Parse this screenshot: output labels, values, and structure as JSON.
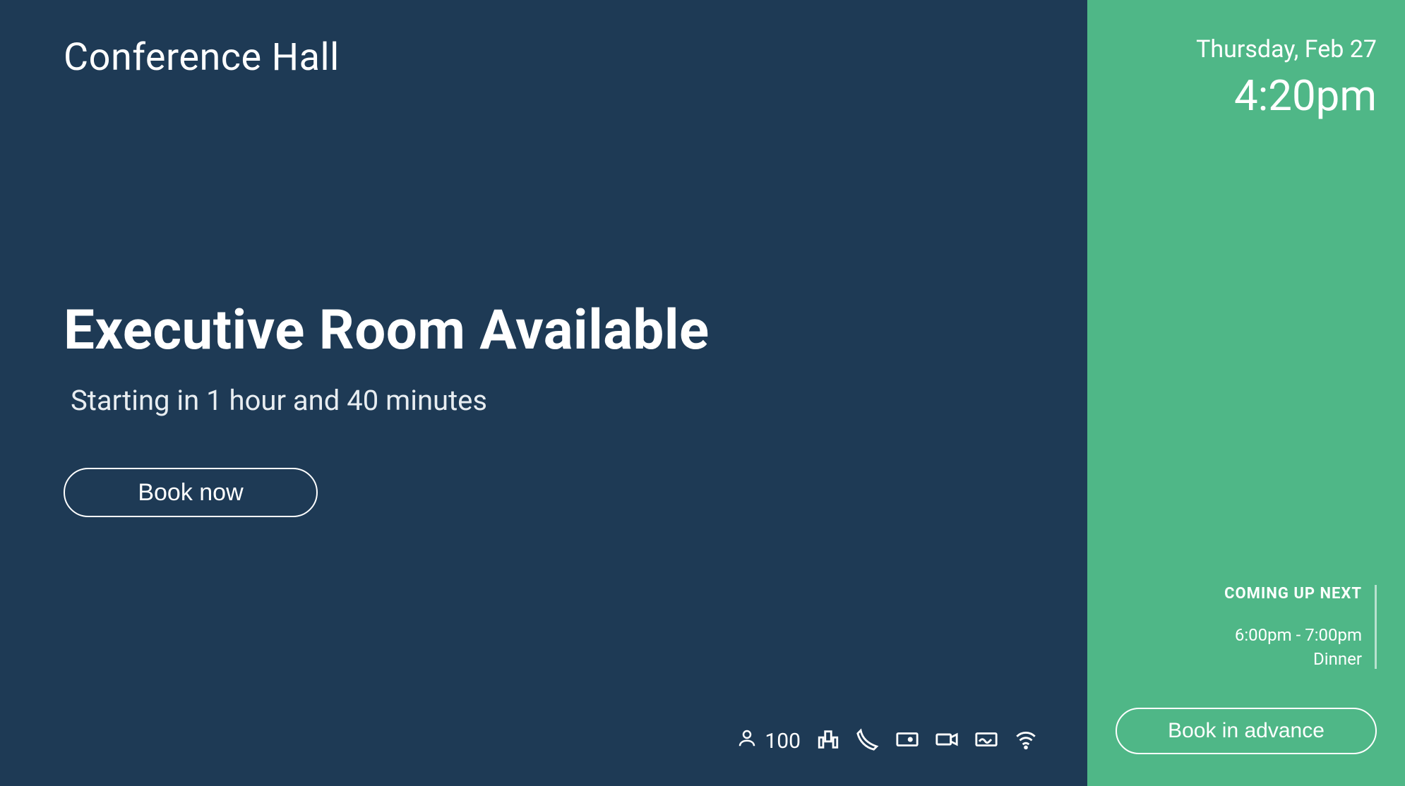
{
  "main": {
    "room_name": "Conference Hall",
    "status_title": "Executive Room Available",
    "status_subtitle": "Starting in 1 hour and 40 minutes",
    "book_now_label": "Book now",
    "capacity": "100"
  },
  "sidebar": {
    "date": "Thursday, Feb 27",
    "time": "4:20pm",
    "upnext_heading": "COMING UP NEXT",
    "upnext_time": "6:00pm - 7:00pm",
    "upnext_title": "Dinner",
    "book_advance_label": "Book in advance"
  },
  "icons": {
    "person": "person-icon",
    "presentation": "presentation-icon",
    "phone": "phone-icon",
    "projector": "projector-icon",
    "video": "video-camera-icon",
    "whiteboard": "whiteboard-icon",
    "wifi": "wifi-icon"
  },
  "colors": {
    "main_bg": "#1e3a55",
    "sidebar_bg": "#4fb787",
    "text": "#ffffff"
  }
}
